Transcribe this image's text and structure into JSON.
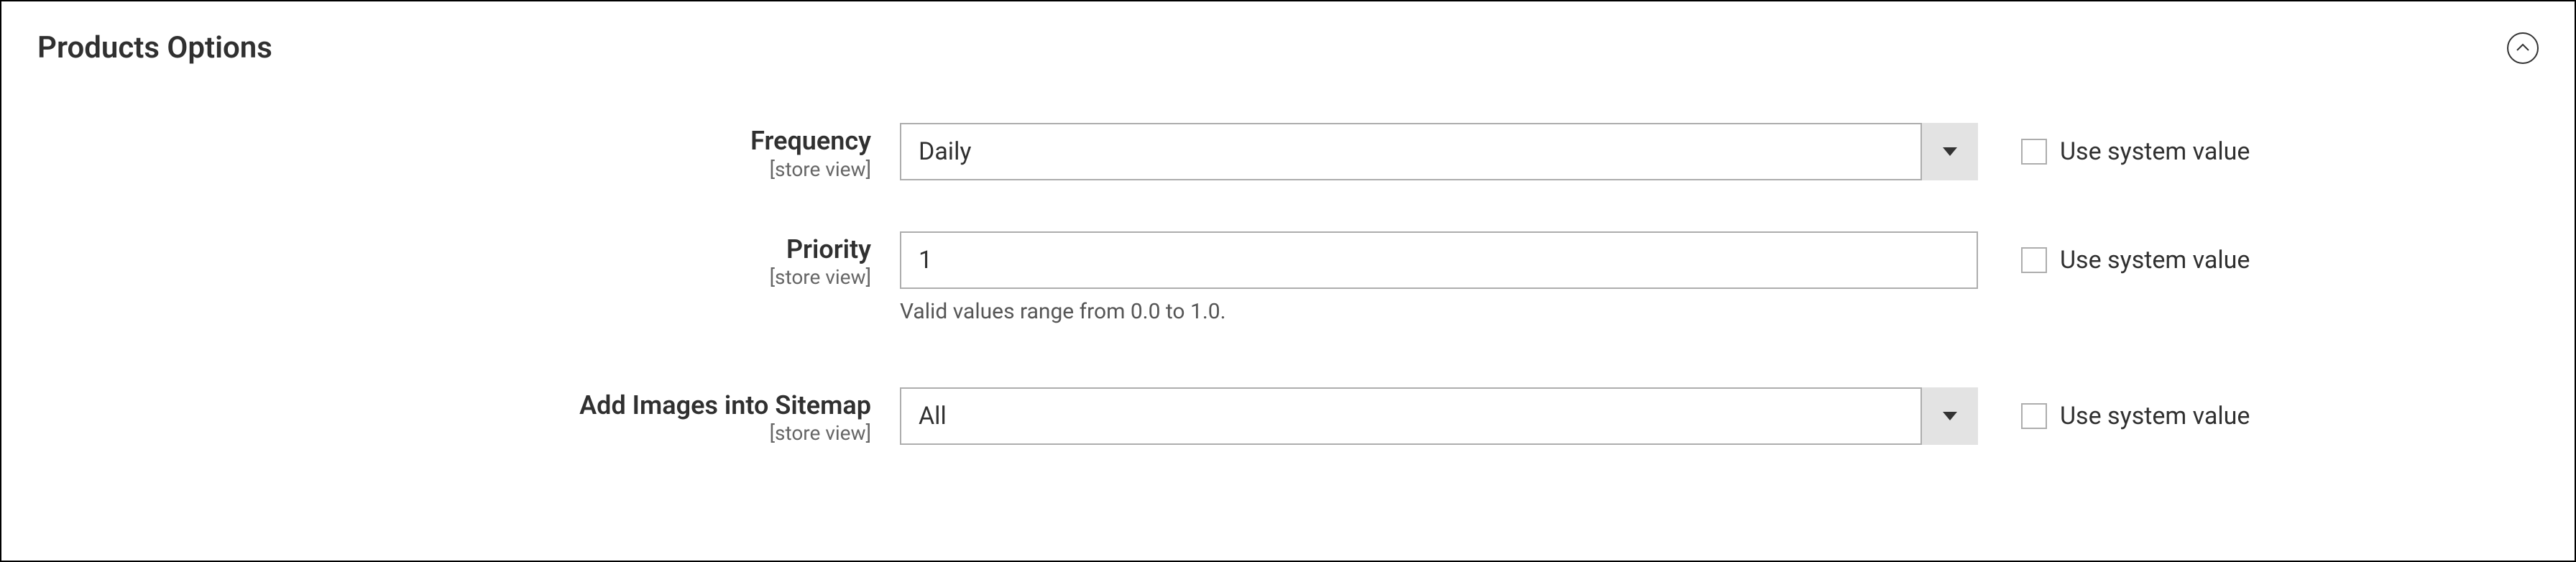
{
  "section": {
    "title": "Products Options"
  },
  "fields": {
    "frequency": {
      "label": "Frequency",
      "scope": "[store view]",
      "value": "Daily",
      "use_system_label": "Use system value"
    },
    "priority": {
      "label": "Priority",
      "scope": "[store view]",
      "value": "1",
      "note": "Valid values range from 0.0 to 1.0.",
      "use_system_label": "Use system value"
    },
    "add_images": {
      "label": "Add Images into Sitemap",
      "scope": "[store view]",
      "value": "All",
      "use_system_label": "Use system value"
    }
  }
}
